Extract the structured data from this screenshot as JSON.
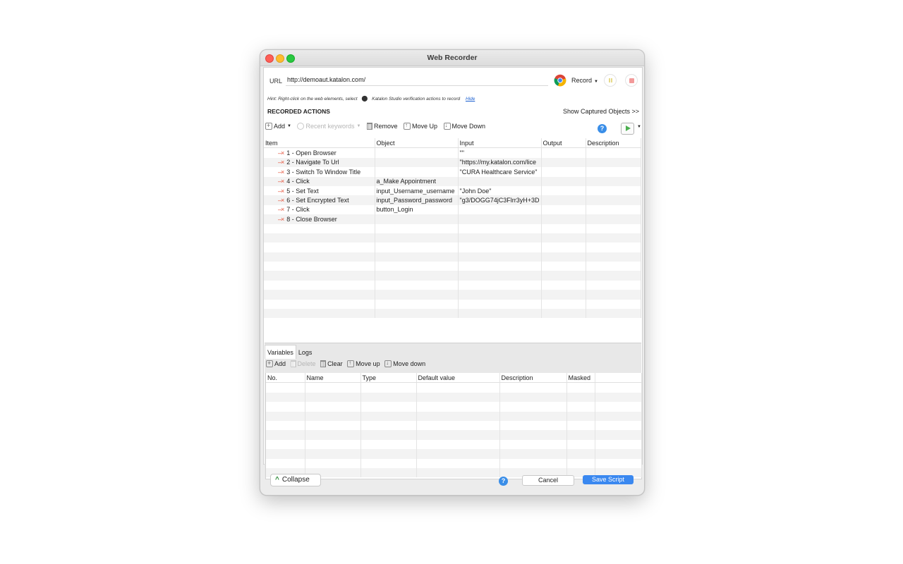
{
  "window": {
    "title": "Web Recorder"
  },
  "url_bar": {
    "label": "URL",
    "value": "http://demoaut.katalon.com/"
  },
  "record": {
    "label": "Record"
  },
  "hint": {
    "text_before": "Hint: Right-click on the web elements, select",
    "text_after": "Katalon Studio verification actions to record",
    "hide_link": "Hide"
  },
  "recorded_actions": {
    "title": "RECORDED ACTIONS",
    "show_captured": "Show Captured Objects >>",
    "toolbar": {
      "add": "Add",
      "recent_keywords": "Recent keywords",
      "remove": "Remove",
      "move_up": "Move Up",
      "move_down": "Move Down"
    },
    "columns": [
      "Item",
      "Object",
      "Input",
      "Output",
      "Description"
    ],
    "rows": [
      {
        "item": "1 - Open Browser",
        "object": "",
        "input": "\"\"",
        "output": "",
        "description": ""
      },
      {
        "item": "2 - Navigate To Url",
        "object": "",
        "input": "\"https://my.katalon.com/lice",
        "output": "",
        "description": ""
      },
      {
        "item": "3 - Switch To Window Title",
        "object": "",
        "input": "\"CURA Healthcare Service\"",
        "output": "",
        "description": ""
      },
      {
        "item": "4 - Click",
        "object": "a_Make Appointment",
        "input": "",
        "output": "",
        "description": ""
      },
      {
        "item": "5 - Set Text",
        "object": "input_Username_username",
        "input": "\"John Doe\"",
        "output": "",
        "description": ""
      },
      {
        "item": "6 - Set Encrypted Text",
        "object": "input_Password_password",
        "input": "\"g3/DOGG74jC3Flrr3yH+3D",
        "output": "",
        "description": ""
      },
      {
        "item": "7 - Click",
        "object": "button_Login",
        "input": "",
        "output": "",
        "description": ""
      },
      {
        "item": "8 - Close Browser",
        "object": "",
        "input": "",
        "output": "",
        "description": ""
      }
    ]
  },
  "variables_panel": {
    "tabs": [
      "Variables",
      "Logs"
    ],
    "toolbar": {
      "add": "Add",
      "delete": "Delete",
      "clear": "Clear",
      "move_up": "Move up",
      "move_down": "Move down"
    },
    "columns": [
      "No.",
      "Name",
      "Type",
      "Default value",
      "Description",
      "Masked"
    ]
  },
  "footer": {
    "collapse": "Collapse",
    "cancel": "Cancel",
    "save": "Save Script"
  },
  "colors": {
    "primary_button": "#3a88f0",
    "help_icon": "#3a8ee8",
    "remove_x": "#e5533b",
    "run_green": "#4caf50"
  }
}
